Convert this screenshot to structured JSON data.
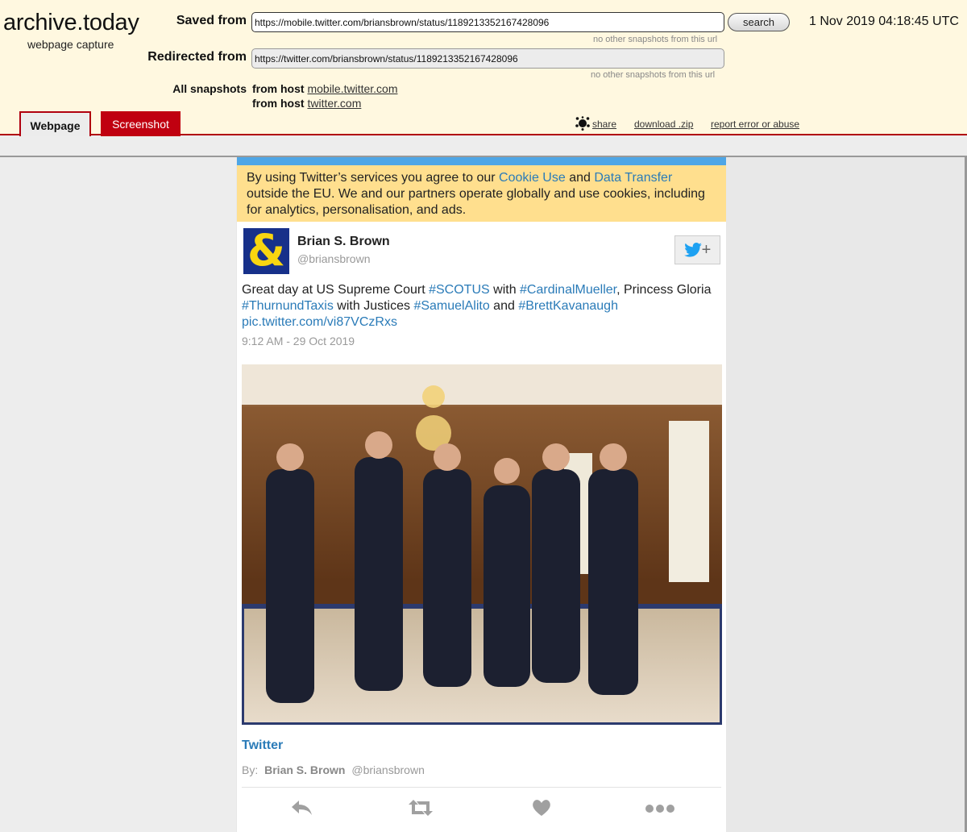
{
  "archive": {
    "logo": "archive.today",
    "logo_subtitle": "webpage capture",
    "saved_from_label": "Saved from",
    "saved_from_url": "https://mobile.twitter.com/briansbrown/status/1189213352167428096",
    "saved_from_note": "no other snapshots from this url",
    "redirected_from_label": "Redirected from",
    "redirected_from_url": "https://twitter.com/briansbrown/status/1189213352167428096",
    "redirected_from_note": "no other snapshots from this url",
    "search_label": "search",
    "capture_date": "1 Nov 2019 04:18:45 UTC",
    "all_snapshots_label": "All snapshots",
    "hosts": [
      {
        "prefix": "from host",
        "host": "mobile.twitter.com"
      },
      {
        "prefix": "from host",
        "host": "twitter.com"
      }
    ],
    "tabs": [
      {
        "label": "Webpage",
        "active": true
      },
      {
        "label": "Screenshot",
        "active": false
      }
    ],
    "tools": {
      "share": "share",
      "download": "download .zip",
      "report": "report error or abuse"
    },
    "colors": {
      "accent": "#b0000f",
      "header_bg": "#fff8e0"
    }
  },
  "tweet_page": {
    "cookie_notice": {
      "before": "By using Twitter’s services you agree to our ",
      "link1": "Cookie Use",
      "middle": " and ",
      "link2": "Data Transfer",
      "after": " outside the EU. We and our partners operate globally and use cookies, including for analytics, personalisation, and ads."
    },
    "author": {
      "name": "Brian S. Brown",
      "handle": "@briansbrown",
      "avatar_glyph": "&"
    },
    "follow_icon": "twitter-bird-plus",
    "tweet": {
      "t1": "Great day at US Supreme Court ",
      "h1": "#SCOTUS",
      "t2": " with ",
      "h2": "#CardinalMueller",
      "t3": ", Princess Gloria ",
      "h3": "#ThurnundTaxis",
      "t4": " with Justices ",
      "h4": "#SamuelAlito",
      "t5": " and ",
      "h5": "#BrettKavanaugh",
      "link": "pic.twitter.com/vi87VCzRxs"
    },
    "timestamp": "9:12 AM - 29 Oct 2019",
    "photo_alt": "Group photo of six people in a wood-paneled room with chandelier",
    "card": {
      "title": "Twitter",
      "by_label": "By:",
      "by_name": "Brian S. Brown",
      "by_handle": "@briansbrown"
    },
    "actions": [
      "reply-icon",
      "retweet-icon",
      "like-icon",
      "more-icon"
    ]
  }
}
